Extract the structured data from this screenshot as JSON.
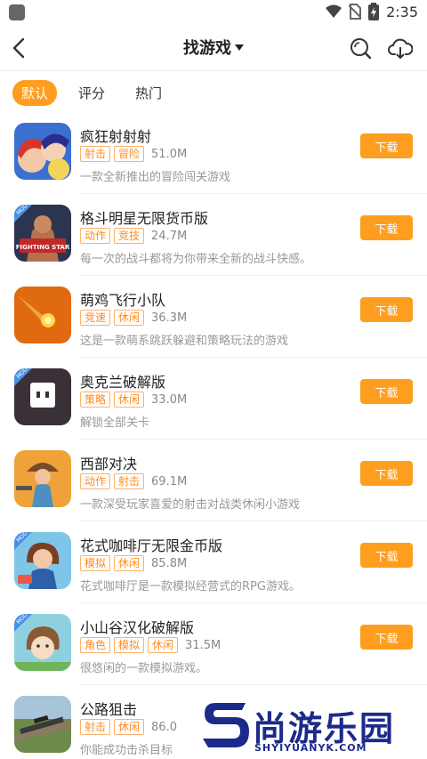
{
  "status_bar": {
    "time": "2:35"
  },
  "nav": {
    "title": "找游戏"
  },
  "tabs": [
    {
      "label": "默认",
      "active": true
    },
    {
      "label": "评分",
      "active": false
    },
    {
      "label": "热门",
      "active": false
    }
  ],
  "download_label": "下载",
  "games": [
    {
      "name": "疯狂射射射",
      "tags": [
        "射击",
        "冒险"
      ],
      "size": "51.0M",
      "desc": "一款全新推出的冒险闯关游戏"
    },
    {
      "name": "格斗明星无限货币版",
      "tags": [
        "动作",
        "竞技"
      ],
      "size": "24.7M",
      "desc": "每一次的战斗都将为你带来全新的战斗快感。",
      "icon_text": "FIGHTING STAR"
    },
    {
      "name": "萌鸡飞行小队",
      "tags": [
        "竞速",
        "休闲"
      ],
      "size": "36.3M",
      "desc": "这是一款萌系跳跃躲避和策略玩法的游戏"
    },
    {
      "name": "奥克兰破解版",
      "tags": [
        "策略",
        "休闲"
      ],
      "size": "33.0M",
      "desc": "解锁全部关卡"
    },
    {
      "name": "西部对决",
      "tags": [
        "动作",
        "射击"
      ],
      "size": "69.1M",
      "desc": "一款深受玩家喜爱的射击对战类休闲小游戏"
    },
    {
      "name": "花式咖啡厅无限金币版",
      "tags": [
        "模拟",
        "休闲"
      ],
      "size": "85.8M",
      "desc": "花式咖啡厅是一款模拟经营式的RPG游戏。"
    },
    {
      "name": "小山谷汉化破解版",
      "tags": [
        "角色",
        "模拟",
        "休闲"
      ],
      "size": "31.5M",
      "desc": "很悠闲的一款模拟游戏。"
    },
    {
      "name": "公路狙击",
      "tags": [
        "射击",
        "休闲"
      ],
      "size": "86.0",
      "desc": "你能成功击杀目标"
    }
  ],
  "mod_badge": "MOD",
  "icons": {
    "back": "back-arrow-icon",
    "search": "search-icon",
    "cloud": "cloud-download-icon"
  },
  "watermark": {
    "text": "尚游乐园",
    "sub": "SHYIYUANYK.COM"
  },
  "colors": {
    "accent": "#ff9d1f",
    "tag_text": "#ff8a1f",
    "watermark": "#1c2a8a"
  }
}
